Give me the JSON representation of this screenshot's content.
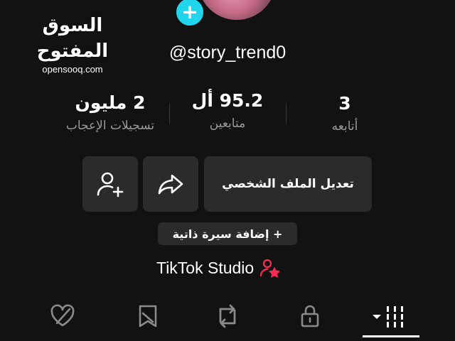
{
  "watermark": {
    "arabic": "السوق المفتوح",
    "latin": "opensooq.com"
  },
  "profile": {
    "username": "@story_trend0"
  },
  "stats": {
    "likes": {
      "value": "2 مليون",
      "label": "تسجيلات الإعجاب"
    },
    "followers": {
      "value": "95.2 أل",
      "label": "متابعين"
    },
    "following": {
      "value": "3",
      "label": "أتابعه"
    }
  },
  "actions": {
    "edit_profile_label": "تعديل الملف الشخصي",
    "add_bio_label": "+ إضافة سيرة ذاتية",
    "studio_label": "TikTok Studio"
  },
  "icons": {
    "add_friend": "add-friend-icon",
    "share": "share-icon",
    "studio": "studio-icon",
    "liked": "liked-heart-icon",
    "favorites": "favorites-icon",
    "reposts": "repost-icon",
    "private": "lock-icon",
    "videos": "grid-icon"
  },
  "colors": {
    "background": "#121212",
    "accent_add": "#20d5ec",
    "studio_icon": "#fe2c55"
  }
}
